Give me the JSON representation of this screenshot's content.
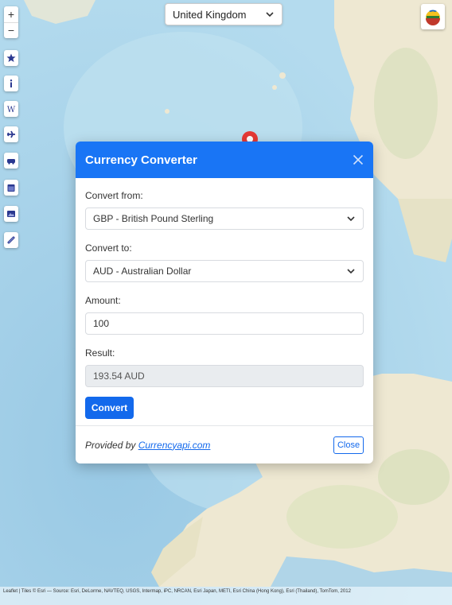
{
  "map": {
    "zoom_in_label": "+",
    "zoom_out_label": "−",
    "tools": [
      {
        "icon": "star-icon"
      },
      {
        "icon": "info-icon"
      },
      {
        "icon": "wiki-icon"
      },
      {
        "icon": "plane-icon"
      },
      {
        "icon": "car-icon"
      },
      {
        "icon": "calendar-icon"
      },
      {
        "icon": "image-icon"
      },
      {
        "icon": "link-icon"
      }
    ],
    "country": "United Kingdom",
    "attribution": "Leaflet | Tiles © Esri — Source: Esri, DeLorme, NAVTEQ, USGS, Intermap, iPC, NRCAN, Esri Japan, METI, Esri China (Hong Kong), Esri (Thailand), TomTom, 2012"
  },
  "modal": {
    "title": "Currency Converter",
    "from_label": "Convert from:",
    "from_value": "GBP - British Pound Sterling",
    "to_label": "Convert to:",
    "to_value": "AUD - Australian Dollar",
    "amount_label": "Amount:",
    "amount_value": "100",
    "result_label": "Result:",
    "result_value": "193.54 AUD",
    "convert_label": "Convert",
    "provided_by": "Provided by",
    "provider_link": "Currencyapi.com",
    "close_label": "Close"
  },
  "colors": {
    "header": "#1975f5",
    "primary": "#1369ec",
    "ocean": "#a9d3ea",
    "land": "#f0ead8"
  }
}
